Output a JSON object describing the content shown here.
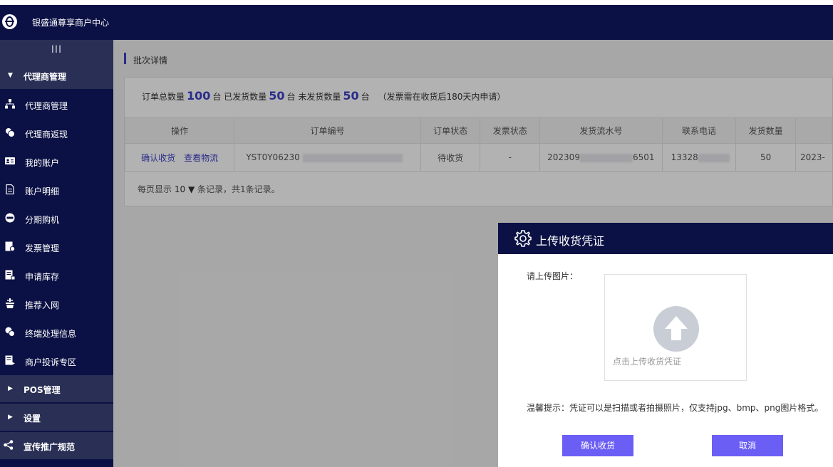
{
  "header": {
    "brand": "银盛通尊享商户中心",
    "logo_icon": "logo-icon"
  },
  "sidebar": {
    "toggle": "III",
    "groups": [
      {
        "label": "代理商管理",
        "expanded": true
      },
      {
        "label": "POS管理",
        "expanded": false
      },
      {
        "label": "设置",
        "expanded": false
      }
    ],
    "items": [
      {
        "label": "代理商管理",
        "icon": "sitemap-icon"
      },
      {
        "label": "代理商返现",
        "icon": "cash-icon"
      },
      {
        "label": "我的账户",
        "icon": "id-card-icon"
      },
      {
        "label": "账户明细",
        "icon": "document-icon"
      },
      {
        "label": "分期购机",
        "icon": "installment-icon"
      },
      {
        "label": "发票管理",
        "icon": "invoice-icon"
      },
      {
        "label": "申请库存",
        "icon": "inventory-icon"
      },
      {
        "label": "推荐入网",
        "icon": "recommend-icon"
      },
      {
        "label": "终端处理信息",
        "icon": "terminal-icon"
      },
      {
        "label": "商户投诉专区",
        "icon": "complaint-icon"
      }
    ],
    "share": {
      "label": "宣传推广规范",
      "icon": "share-icon"
    }
  },
  "page": {
    "breadcrumb": "批次详情",
    "summary": {
      "total_label": "订单总数量",
      "total": "100",
      "unit": "台",
      "shipped_label": "已发货数量",
      "shipped": "50",
      "unshipped_label": "未发货数量",
      "unshipped": "50",
      "note": "（发票需在收货后180天内申请）"
    },
    "table": {
      "headers": [
        "操作",
        "订单编号",
        "订单状态",
        "发票状态",
        "发货流水号",
        "联系电话",
        "发货数量"
      ],
      "row": {
        "actions": [
          "确认收货",
          "查看物流"
        ],
        "order_no": "YST0Y06230",
        "status": "待收货",
        "invoice": "-",
        "serial": "202309",
        "serial_tail": "6501",
        "phone": "13328",
        "qty": "50",
        "date": "2023-"
      }
    },
    "pager": {
      "prefix": "每页显示",
      "size": "10",
      "suffix": "条记录，共1条记录。"
    }
  },
  "dialog": {
    "title": "上传收货凭证",
    "upload_label": "请上传图片：",
    "upload_hint": "点击上传收货凭证",
    "tip": "温馨提示：凭证可以是扫描或者拍摄照片，仅支持jpg、bmp、png图片格式。",
    "confirm": "确认收货",
    "cancel": "取消"
  },
  "colors": {
    "nav": "#0b1144",
    "accent": "#3c3ec8",
    "button": "#6b5ef5"
  }
}
